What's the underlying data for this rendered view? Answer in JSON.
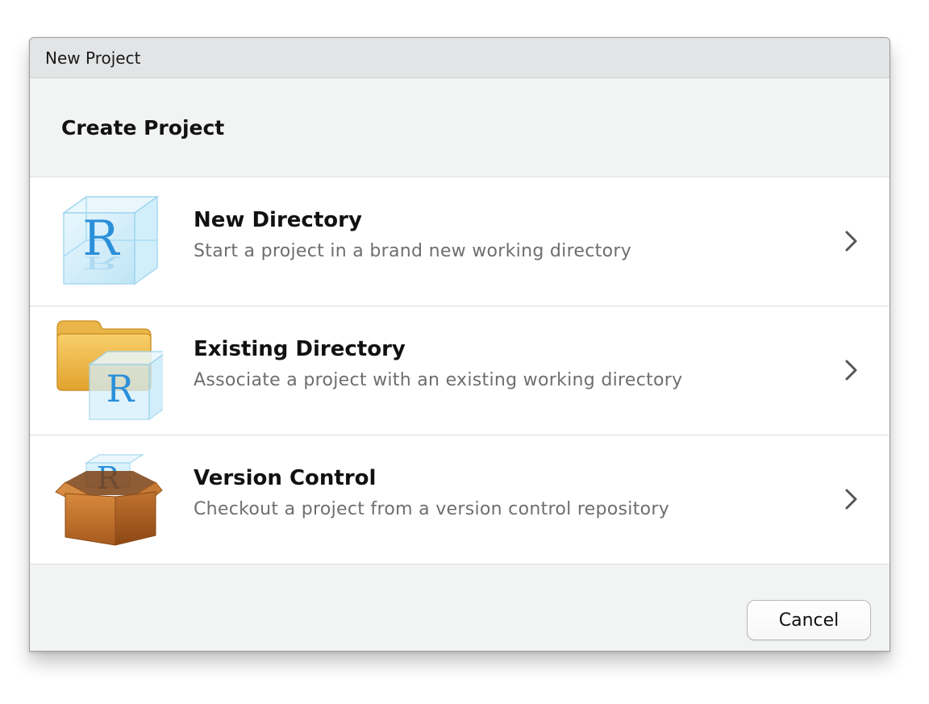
{
  "window": {
    "title": "New Project"
  },
  "header": {
    "title": "Create Project"
  },
  "options": [
    {
      "title": "New Directory",
      "description": "Start a project in a brand new working directory",
      "icon": "r-cube-icon"
    },
    {
      "title": "Existing Directory",
      "description": "Associate a project with an existing working directory",
      "icon": "folder-r-cube-icon"
    },
    {
      "title": "Version Control",
      "description": "Checkout a project from a version control repository",
      "icon": "box-r-cube-icon"
    }
  ],
  "footer": {
    "cancel_label": "Cancel"
  },
  "colors": {
    "title_bar": "#e3e4e6",
    "dialog_background": "#f2f3f3",
    "row_background": "#ffffff",
    "description_text": "#6e6e6e",
    "r_logo_blue": "#2b8fd9"
  }
}
